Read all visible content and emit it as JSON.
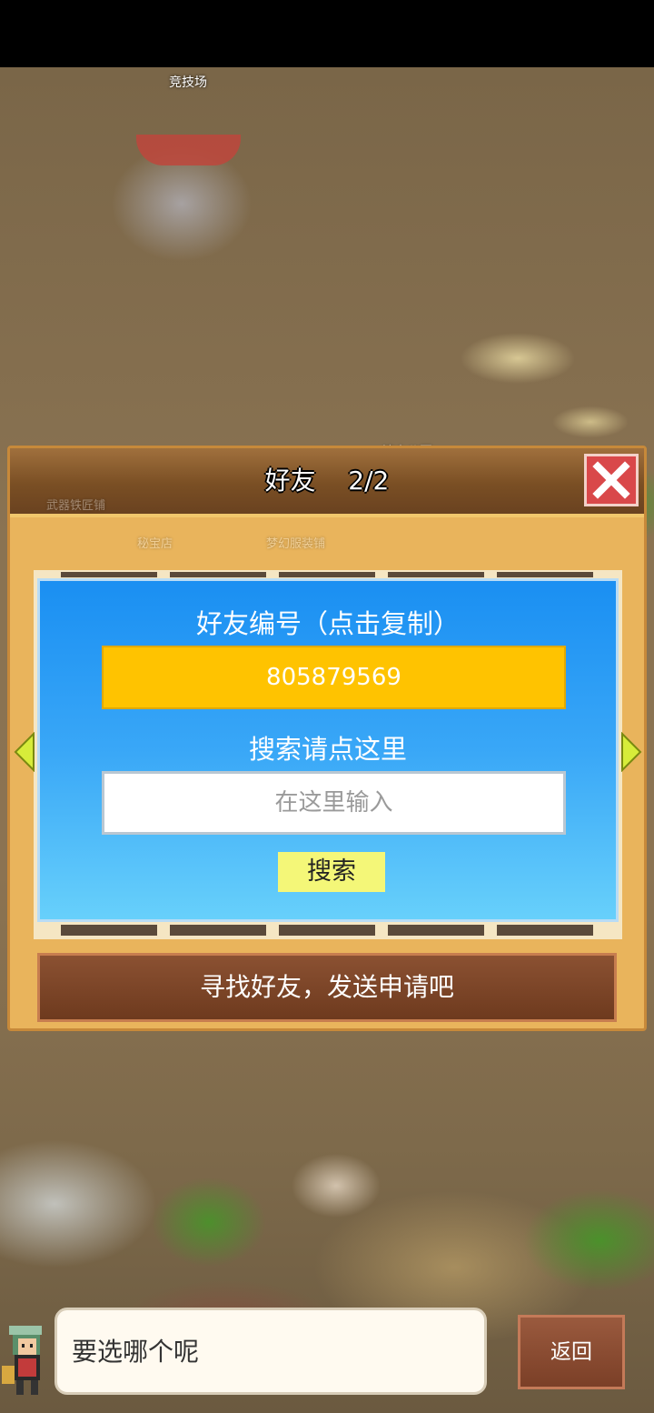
{
  "map": {
    "labels": {
      "arena": "竞技场",
      "blur_a": "神木公园",
      "blur_b": "武器铁匠铺",
      "blur_c": "秘宝店",
      "blur_d": "梦幻服装铺"
    }
  },
  "dialog": {
    "title": "好友    2/2",
    "close_icon": "close-x-icon",
    "friend_id_label": "好友编号（点击复制）",
    "friend_id": "805879569",
    "search_label": "搜索请点这里",
    "search_placeholder": "在这里输入",
    "search_value": "",
    "search_button": "搜索",
    "find_friends_banner": "寻找好友，发送申请吧"
  },
  "bottom": {
    "speech": "要选哪个呢",
    "back_button": "返回"
  },
  "colors": {
    "panel_blue": "#1a8ff2",
    "id_box_yellow": "#ffc300",
    "search_button": "#f4f778",
    "close_red": "#d9484a",
    "banner_brown": "#7b3f27"
  }
}
